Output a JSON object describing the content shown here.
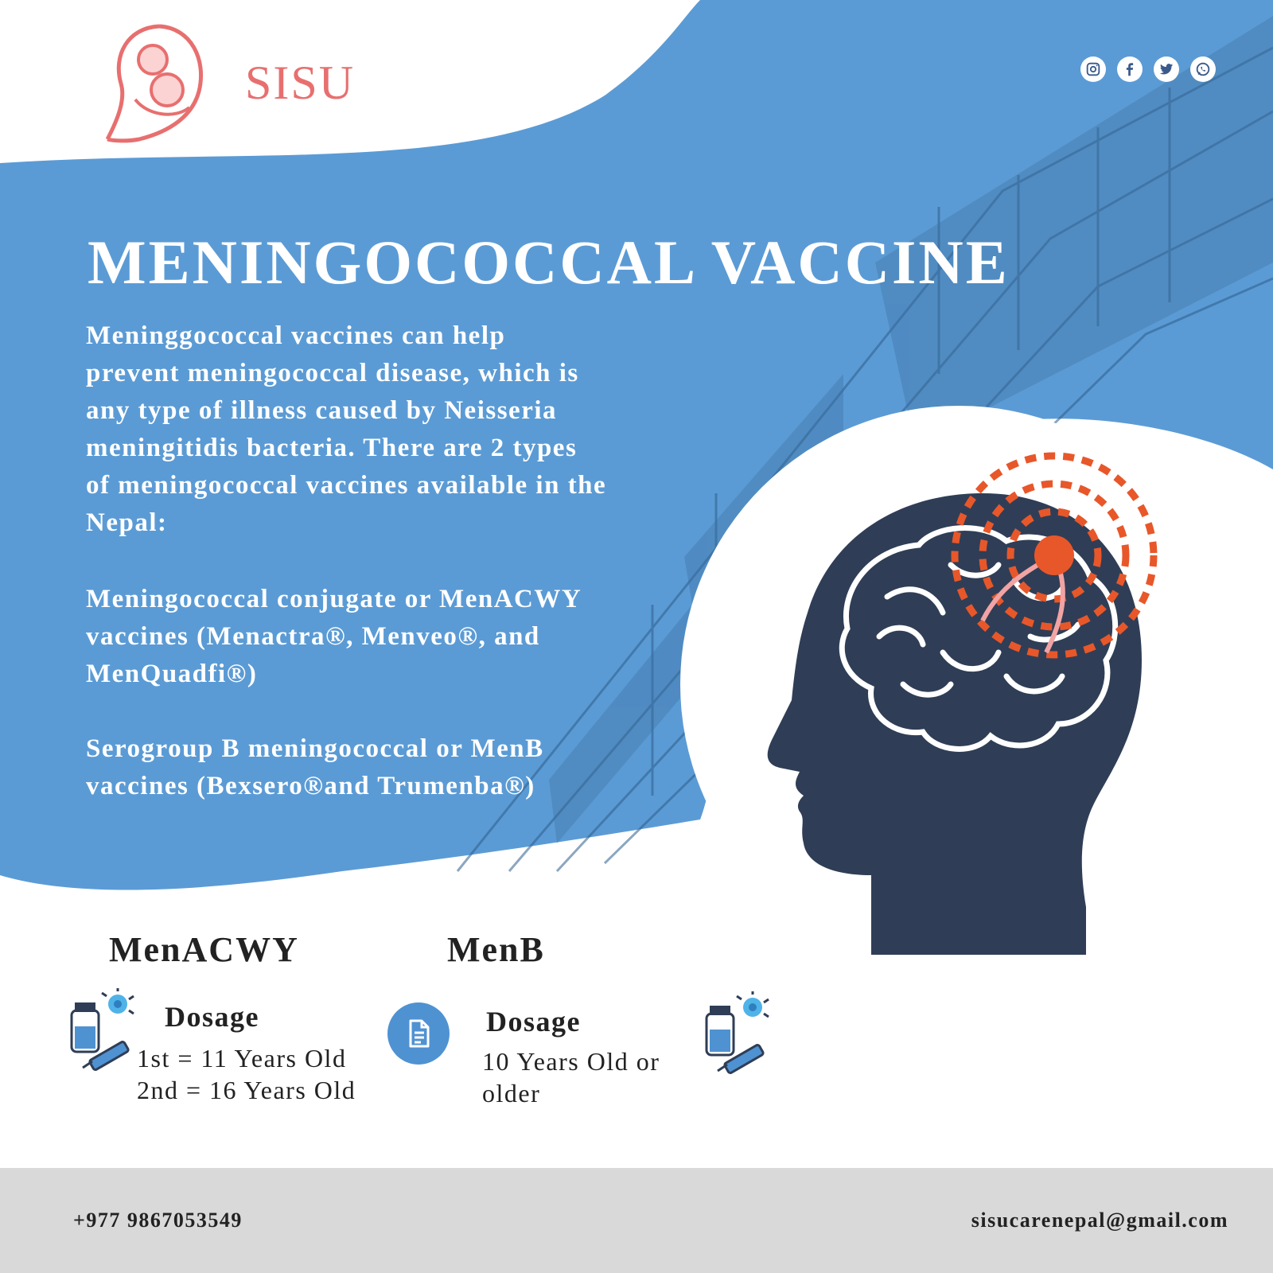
{
  "brand": {
    "name": "SISU"
  },
  "social": [
    "instagram-icon",
    "facebook-icon",
    "twitter-icon",
    "whatsapp-icon"
  ],
  "title": "MENINGOCOCCAL VACCINE",
  "intro": {
    "p1_lines": [
      "Meninggococcal vaccines can help",
      "prevent meningococcal disease, which is",
      "any type of illness caused by Neisseria",
      "meningitidis bacteria. There are 2 types",
      "of meningococcal vaccines available in the",
      "Nepal:"
    ],
    "p2_lines": [
      "Meningococcal conjugate or MenACWY",
      "vaccines (Menactra®, Menveo®, and",
      "MenQuadfi®)"
    ],
    "p3_lines": [
      "Serogroup B meningococcal or MenB",
      "vaccines (Bexsero®and Trumenba®)"
    ]
  },
  "menacwy": {
    "heading": "MenACWY",
    "dosage_label": "Dosage",
    "dose1": "1st = 11 Years Old",
    "dose2": "2nd = 16 Years Old"
  },
  "menb": {
    "heading": "MenB",
    "dosage_label": "Dosage",
    "dose": "10 Years Old or older"
  },
  "footer": {
    "phone": "+977 9867053549",
    "email": "sisucarenepal@gmail.com"
  },
  "colors": {
    "brand": "#e86f6f",
    "blue": "#5b9bd5",
    "navy": "#2f3e56",
    "alert": "#e8572a",
    "footer": "#d9d9d9"
  }
}
